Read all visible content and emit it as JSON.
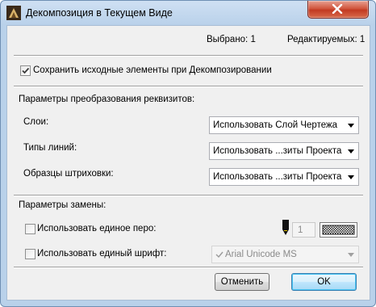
{
  "window": {
    "title": "Декомпозиция в Текущем Виде",
    "icons": {
      "app": "archicad-icon",
      "close": "close-icon"
    }
  },
  "status": {
    "selected": "Выбрано: 1",
    "editable": "Редактируемых: 1"
  },
  "keep_originals": {
    "label": "Сохранить исходные элементы при Декомпозировании",
    "checked": true
  },
  "conversion": {
    "heading": "Параметры преобразования реквизитов:",
    "rows": [
      {
        "label": "Слои:",
        "value": "Использовать Слой Чертежа"
      },
      {
        "label": "Типы линий:",
        "value": "Использовать ...зиты Проекта"
      },
      {
        "label": "Образцы штриховки:",
        "value": "Использовать ...зиты Проекта"
      }
    ]
  },
  "replace": {
    "heading": "Параметры замены:",
    "pen": {
      "label": "Использовать единое перо:",
      "checked": false,
      "value": "1",
      "icon": "pen-icon"
    },
    "font": {
      "label": "Использовать единый шрифт:",
      "checked": false,
      "value": "Arial Unicode MS",
      "icon": "checkmark-icon"
    }
  },
  "buttons": {
    "cancel": "Отменить",
    "ok": "OK"
  },
  "colors": {
    "title_bg": "#b9d1ea",
    "client_bg": "#f0f0f0",
    "close": "#c7432a",
    "ok_border": "#3c7fb1"
  }
}
